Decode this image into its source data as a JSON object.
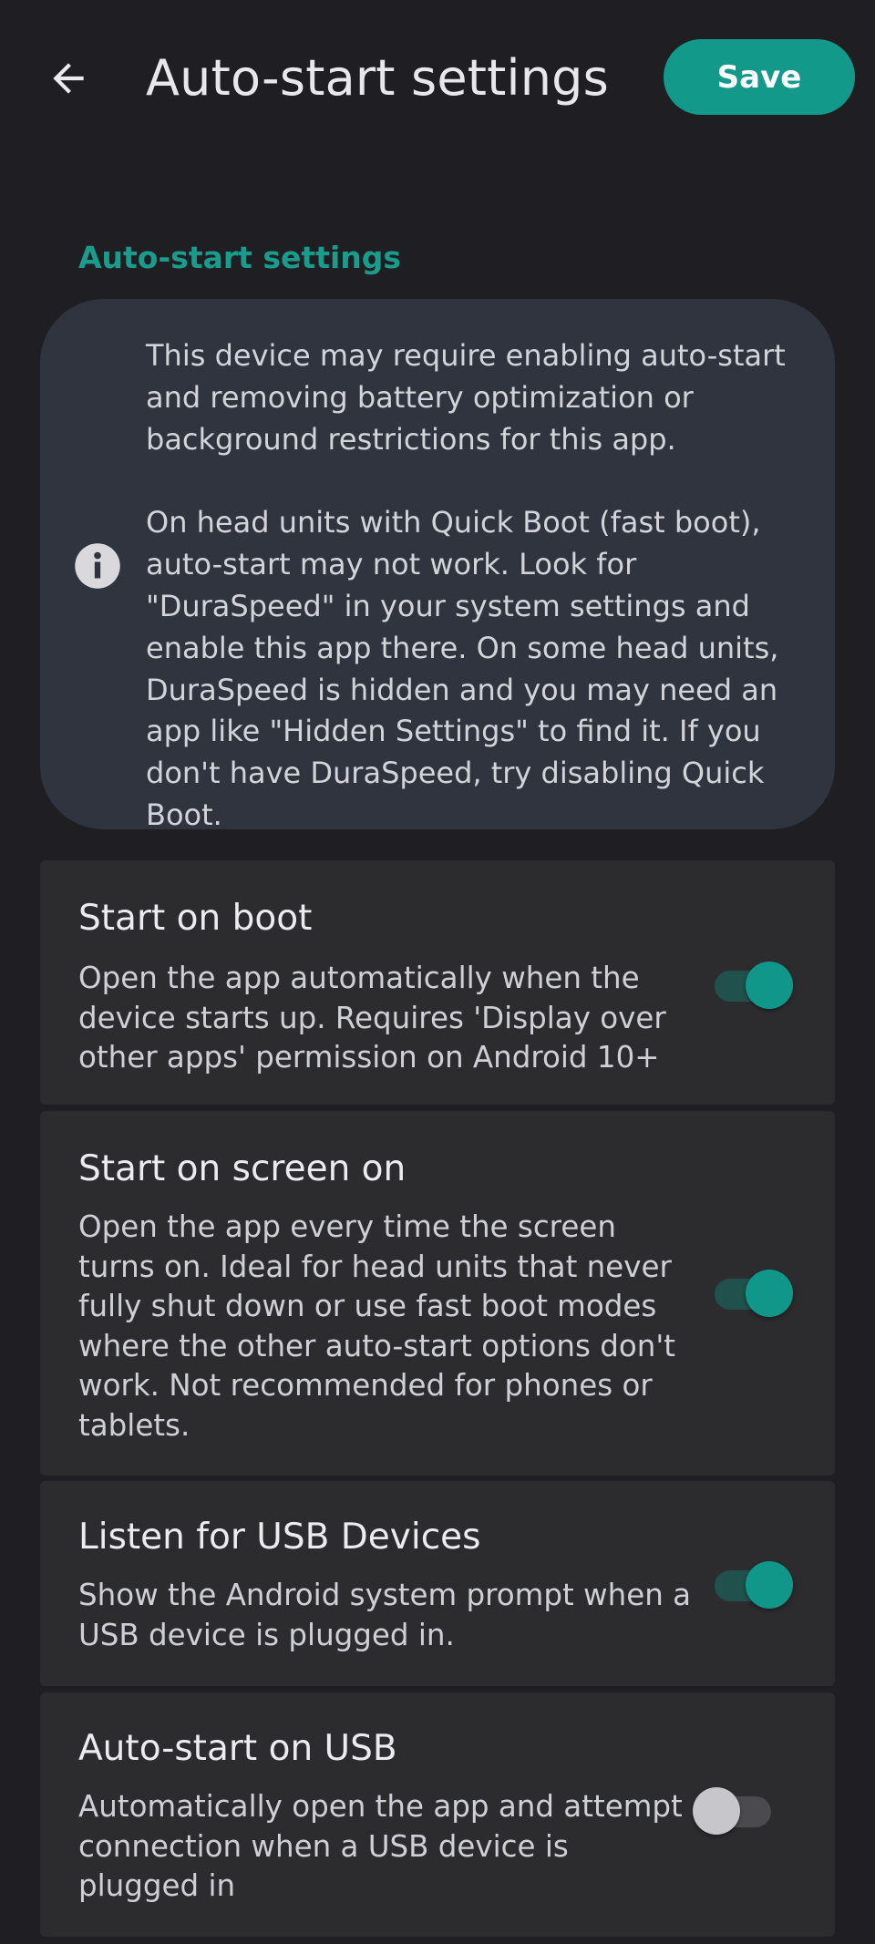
{
  "app_bar": {
    "title": "Auto-start settings",
    "save_label": "Save",
    "back_icon": "arrow-left-icon"
  },
  "section": {
    "title": "Auto-start settings"
  },
  "info": {
    "icon": "info-icon",
    "paragraph_1": "This device may require enabling auto-start and removing battery optimization or background restrictions for this app.",
    "paragraph_2": "On head units with Quick Boot (fast boot), auto-start may not work. Look for \"DuraSpeed\" in your system settings and enable this app there. On some head units, DuraSpeed is hidden and you may need an app like \"Hidden Settings\" to find it. If you don't have DuraSpeed, try disabling Quick Boot."
  },
  "settings": [
    {
      "title": "Start on boot",
      "description": "Open the app automatically when the device starts up. Requires 'Display over other apps' permission on Android 10+",
      "enabled": true
    },
    {
      "title": "Start on screen on",
      "description": "Open the app every time the screen turns on. Ideal for head units that never fully shut down or use fast boot modes where the other auto-start options don't work. Not recommended for phones or tablets.",
      "enabled": true
    },
    {
      "title": "Listen for USB Devices",
      "description": "Show the Android system prompt when a USB device is plugged in.",
      "enabled": true
    },
    {
      "title": "Auto-start on USB",
      "description": "Automatically open the app and attempt connection when a USB device is plugged in",
      "enabled": false
    }
  ],
  "colors": {
    "background": "#1f1f23",
    "accent": "#12998a",
    "info_card": "#2f343f",
    "setting_card": "#2c2c2e"
  }
}
